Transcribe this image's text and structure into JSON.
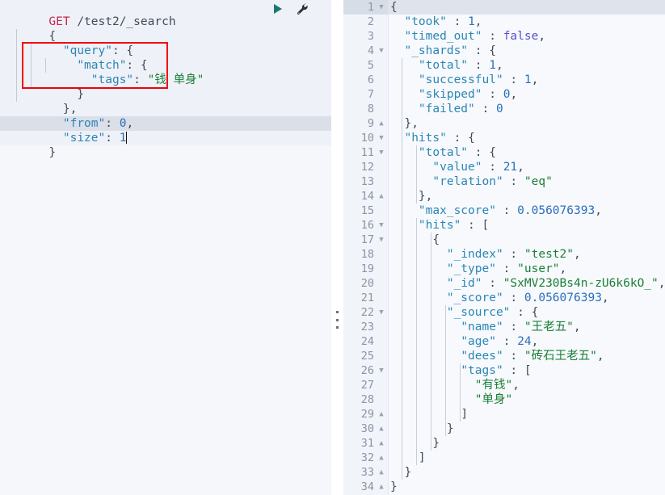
{
  "request": {
    "method": "GET",
    "path": "/test2/_search",
    "body_lines": [
      "{",
      "  \"query\": {",
      "    \"match\": {",
      "      \"tags\": \"钱 单身\"",
      "    }",
      "  },",
      "  \"from\": 0,",
      "  \"size\": 1",
      "}"
    ],
    "active_line_text": "  \"size\": 1",
    "cursor_line": 8,
    "highlight_box": {
      "color": "#f3000b",
      "lines": [
        "    \"match\": {",
        "      \"tags\": \"钱 单身\"",
        "    }"
      ]
    }
  },
  "toolbar": {
    "play_label": "send-request",
    "play_color": "#1a7a72",
    "wrench_label": "request-options",
    "wrench_color": "#2b3a4a"
  },
  "response": {
    "lines": [
      {
        "n": 1,
        "fold": "down",
        "text": "{"
      },
      {
        "n": 2,
        "fold": "",
        "text": "  \"took\" : 1,"
      },
      {
        "n": 3,
        "fold": "",
        "text": "  \"timed_out\" : false,"
      },
      {
        "n": 4,
        "fold": "down",
        "text": "  \"_shards\" : {"
      },
      {
        "n": 5,
        "fold": "",
        "text": "    \"total\" : 1,"
      },
      {
        "n": 6,
        "fold": "",
        "text": "    \"successful\" : 1,"
      },
      {
        "n": 7,
        "fold": "",
        "text": "    \"skipped\" : 0,"
      },
      {
        "n": 8,
        "fold": "",
        "text": "    \"failed\" : 0"
      },
      {
        "n": 9,
        "fold": "up",
        "text": "  },"
      },
      {
        "n": 10,
        "fold": "down",
        "text": "  \"hits\" : {"
      },
      {
        "n": 11,
        "fold": "down",
        "text": "    \"total\" : {"
      },
      {
        "n": 12,
        "fold": "",
        "text": "      \"value\" : 21,"
      },
      {
        "n": 13,
        "fold": "",
        "text": "      \"relation\" : \"eq\""
      },
      {
        "n": 14,
        "fold": "up",
        "text": "    },"
      },
      {
        "n": 15,
        "fold": "",
        "text": "    \"max_score\" : 0.056076393,"
      },
      {
        "n": 16,
        "fold": "down",
        "text": "    \"hits\" : ["
      },
      {
        "n": 17,
        "fold": "down",
        "text": "      {"
      },
      {
        "n": 18,
        "fold": "",
        "text": "        \"_index\" : \"test2\","
      },
      {
        "n": 19,
        "fold": "",
        "text": "        \"_type\" : \"user\","
      },
      {
        "n": 20,
        "fold": "",
        "text": "        \"_id\" : \"SxMV230Bs4n-zU6k6kO_\","
      },
      {
        "n": 21,
        "fold": "",
        "text": "        \"_score\" : 0.056076393,"
      },
      {
        "n": 22,
        "fold": "down",
        "text": "        \"_source\" : {"
      },
      {
        "n": 23,
        "fold": "",
        "text": "          \"name\" : \"王老五\","
      },
      {
        "n": 24,
        "fold": "",
        "text": "          \"age\" : 24,"
      },
      {
        "n": 25,
        "fold": "",
        "text": "          \"dees\" : \"砖石王老五\","
      },
      {
        "n": 26,
        "fold": "down",
        "text": "          \"tags\" : ["
      },
      {
        "n": 27,
        "fold": "",
        "text": "            \"有钱\","
      },
      {
        "n": 28,
        "fold": "",
        "text": "            \"单身\""
      },
      {
        "n": 29,
        "fold": "up",
        "text": "          ]"
      },
      {
        "n": 30,
        "fold": "up",
        "text": "        }"
      },
      {
        "n": 31,
        "fold": "up",
        "text": "      }"
      },
      {
        "n": 32,
        "fold": "up",
        "text": "    ]"
      },
      {
        "n": 33,
        "fold": "up",
        "text": "  }"
      },
      {
        "n": 34,
        "fold": "up",
        "text": "}"
      }
    ],
    "active_line": 1,
    "data": {
      "took": 1,
      "timed_out": false,
      "_shards": {
        "total": 1,
        "successful": 1,
        "skipped": 0,
        "failed": 0
      },
      "hits": {
        "total": {
          "value": 21,
          "relation": "eq"
        },
        "max_score": 0.056076393,
        "hits": [
          {
            "_index": "test2",
            "_type": "user",
            "_id": "SxMV230Bs4n-zU6k6kO_",
            "_score": 0.056076393,
            "_source": {
              "name": "王老五",
              "age": 24,
              "dees": "砖石王老五",
              "tags": [
                "有钱",
                "单身"
              ]
            }
          }
        ]
      }
    }
  },
  "divider": {
    "handle_label": "resize-panels"
  }
}
